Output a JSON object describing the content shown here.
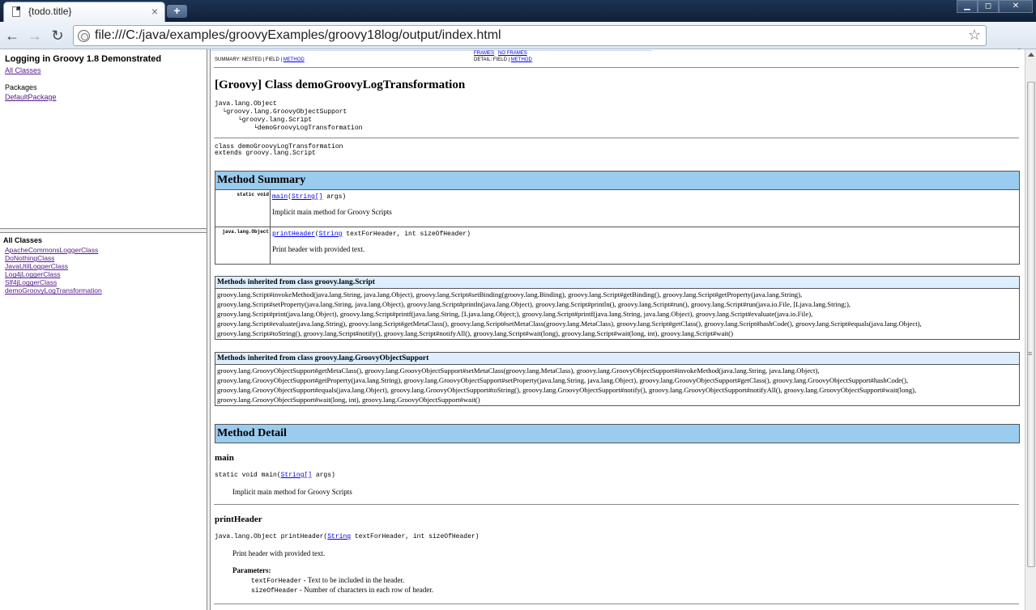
{
  "browser": {
    "tab_title": "{todo.title}",
    "tab_close": "×",
    "new_tab": "+",
    "url": "file:///C:/java/examples/groovyExamples/groovy18log/output/index.html",
    "win_min": "▁",
    "win_max": "◻",
    "win_close": "✕"
  },
  "left_top": {
    "title": "Logging in Groovy 1.8 Demonstrated",
    "all_classes_link": "All Classes",
    "packages_label": "Packages",
    "package_link": "DefaultPackage"
  },
  "left_bottom": {
    "label": "All Classes",
    "classes": [
      "ApacheCommonsLoggerClass",
      "DoNothingClass",
      "JavaUtilLoggerClass",
      "Log4jLoggerClass",
      "Slf4jLoggerClass",
      "demoGroovyLogTransformation"
    ]
  },
  "main": {
    "nav": {
      "summary_prefix": "SUMMARY: NESTED | FIELD | ",
      "summary_method": "METHOD",
      "frames": "FRAMES",
      "no_frames": "NO FRAMES",
      "detail_prefix": "DETAIL: FIELD | ",
      "detail_method": "METHOD"
    },
    "class_title": "[Groovy] Class demoGroovyLogTransformation",
    "tree": [
      "java.lang.Object",
      "  └groovy.lang.GroovyObjectSupport",
      "      └groovy.lang.Script",
      "          └demoGroovyLogTransformation"
    ],
    "decl_line1": "class demoGroovyLogTransformation",
    "decl_line2": "extends groovy.lang.Script",
    "method_summary": {
      "heading": "Method Summary",
      "rows": [
        {
          "modifier": "static void",
          "name": "main",
          "param_type": "String[]",
          "param_rest": " args)",
          "description": "Implicit main method for Groovy Scripts"
        },
        {
          "modifier": "java.lang.Object",
          "name": "printHeader",
          "param_type": "String",
          "param_rest": " textForHeader, int sizeOfHeader)",
          "description": "Print header with provided text."
        }
      ]
    },
    "inherited_script": {
      "heading": "Methods inherited from class groovy.lang.Script",
      "lines": [
        "groovy.lang.Script#invokeMethod(java.lang.String, java.lang.Object), groovy.lang.Script#setBinding(groovy.lang.Binding), groovy.lang.Script#getBinding(), groovy.lang.Script#getProperty(java.lang.String),",
        "groovy.lang.Script#setProperty(java.lang.String, java.lang.Object), groovy.lang.Script#println(java.lang.Object), groovy.lang.Script#println(), groovy.lang.Script#run(), groovy.lang.Script#run(java.io.File, [Ljava.lang.String;),",
        "groovy.lang.Script#print(java.lang.Object), groovy.lang.Script#printf(java.lang.String, [Ljava.lang.Object;), groovy.lang.Script#printf(java.lang.String, java.lang.Object), groovy.lang.Script#evaluate(java.io.File),",
        "groovy.lang.Script#evaluate(java.lang.String), groovy.lang.Script#getMetaClass(), groovy.lang.Script#setMetaClass(groovy.lang.MetaClass), groovy.lang.Script#getClass(), groovy.lang.Script#hashCode(), groovy.lang.Script#equals(java.lang.Object),",
        "groovy.lang.Script#toString(), groovy.lang.Script#notify(), groovy.lang.Script#notifyAll(), groovy.lang.Script#wait(long), groovy.lang.Script#wait(long, int), groovy.lang.Script#wait()"
      ]
    },
    "inherited_gos": {
      "heading": "Methods inherited from class groovy.lang.GroovyObjectSupport",
      "lines": [
        "groovy.lang.GroovyObjectSupport#getMetaClass(), groovy.lang.GroovyObjectSupport#setMetaClass(groovy.lang.MetaClass), groovy.lang.GroovyObjectSupport#invokeMethod(java.lang.String, java.lang.Object),",
        "groovy.lang.GroovyObjectSupport#getProperty(java.lang.String), groovy.lang.GroovyObjectSupport#setProperty(java.lang.String, java.lang.Object), groovy.lang.GroovyObjectSupport#getClass(), groovy.lang.GroovyObjectSupport#hashCode(),",
        "groovy.lang.GroovyObjectSupport#equals(java.lang.Object), groovy.lang.GroovyObjectSupport#toString(), groovy.lang.GroovyObjectSupport#notify(), groovy.lang.GroovyObjectSupport#notifyAll(), groovy.lang.GroovyObjectSupport#wait(long),",
        "groovy.lang.GroovyObjectSupport#wait(long, int), groovy.lang.GroovyObjectSupport#wait()"
      ]
    },
    "method_detail": {
      "heading": "Method Detail",
      "main": {
        "name": "main",
        "sig_prefix": "static void main(",
        "sig_type": "String[]",
        "sig_rest": " args)",
        "description": "Implicit main method for Groovy Scripts"
      },
      "printHeader": {
        "name": "printHeader",
        "sig_prefix": "java.lang.Object printHeader(",
        "sig_type": "String",
        "sig_rest": " textForHeader, int sizeOfHeader)",
        "description": "Print header with provided text.",
        "params_label": "Parameters:",
        "params": [
          {
            "name": "textForHeader",
            "desc": " - Text to be included in the header."
          },
          {
            "name": "sizeOfHeader",
            "desc": " - Number of characters in each row of header."
          }
        ]
      }
    }
  },
  "colors": {
    "summary_header": "#99ccee",
    "inherited_header": "#ddeeff",
    "link": "#0000ee",
    "visited_link": "#551a8b"
  }
}
